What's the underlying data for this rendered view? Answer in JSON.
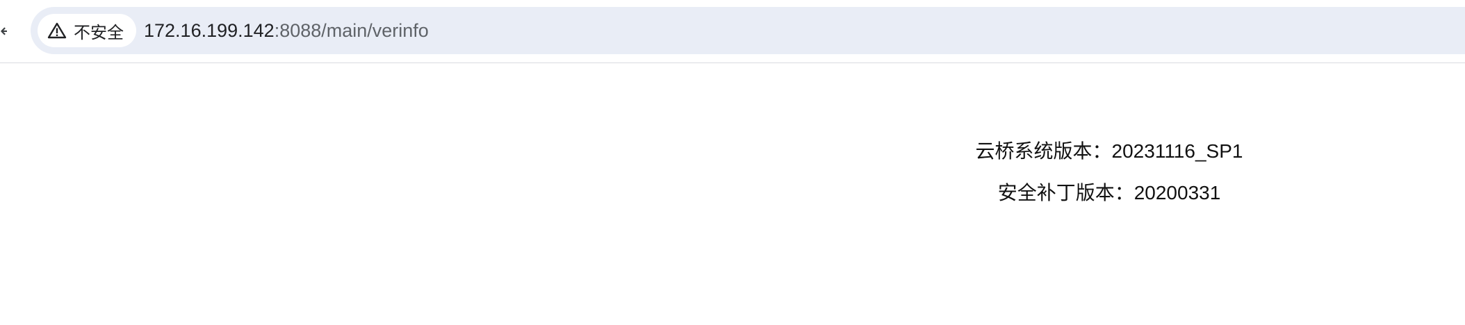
{
  "browser": {
    "security_chip": {
      "icon": "warning-triangle-icon",
      "label": "不安全"
    },
    "url": {
      "host": "172.16.199.142",
      "rest": ":8088/main/verinfo"
    }
  },
  "page": {
    "system_version": "云桥系统版本：20231116_SP1",
    "patch_version": "安全补丁版本：20200331"
  }
}
